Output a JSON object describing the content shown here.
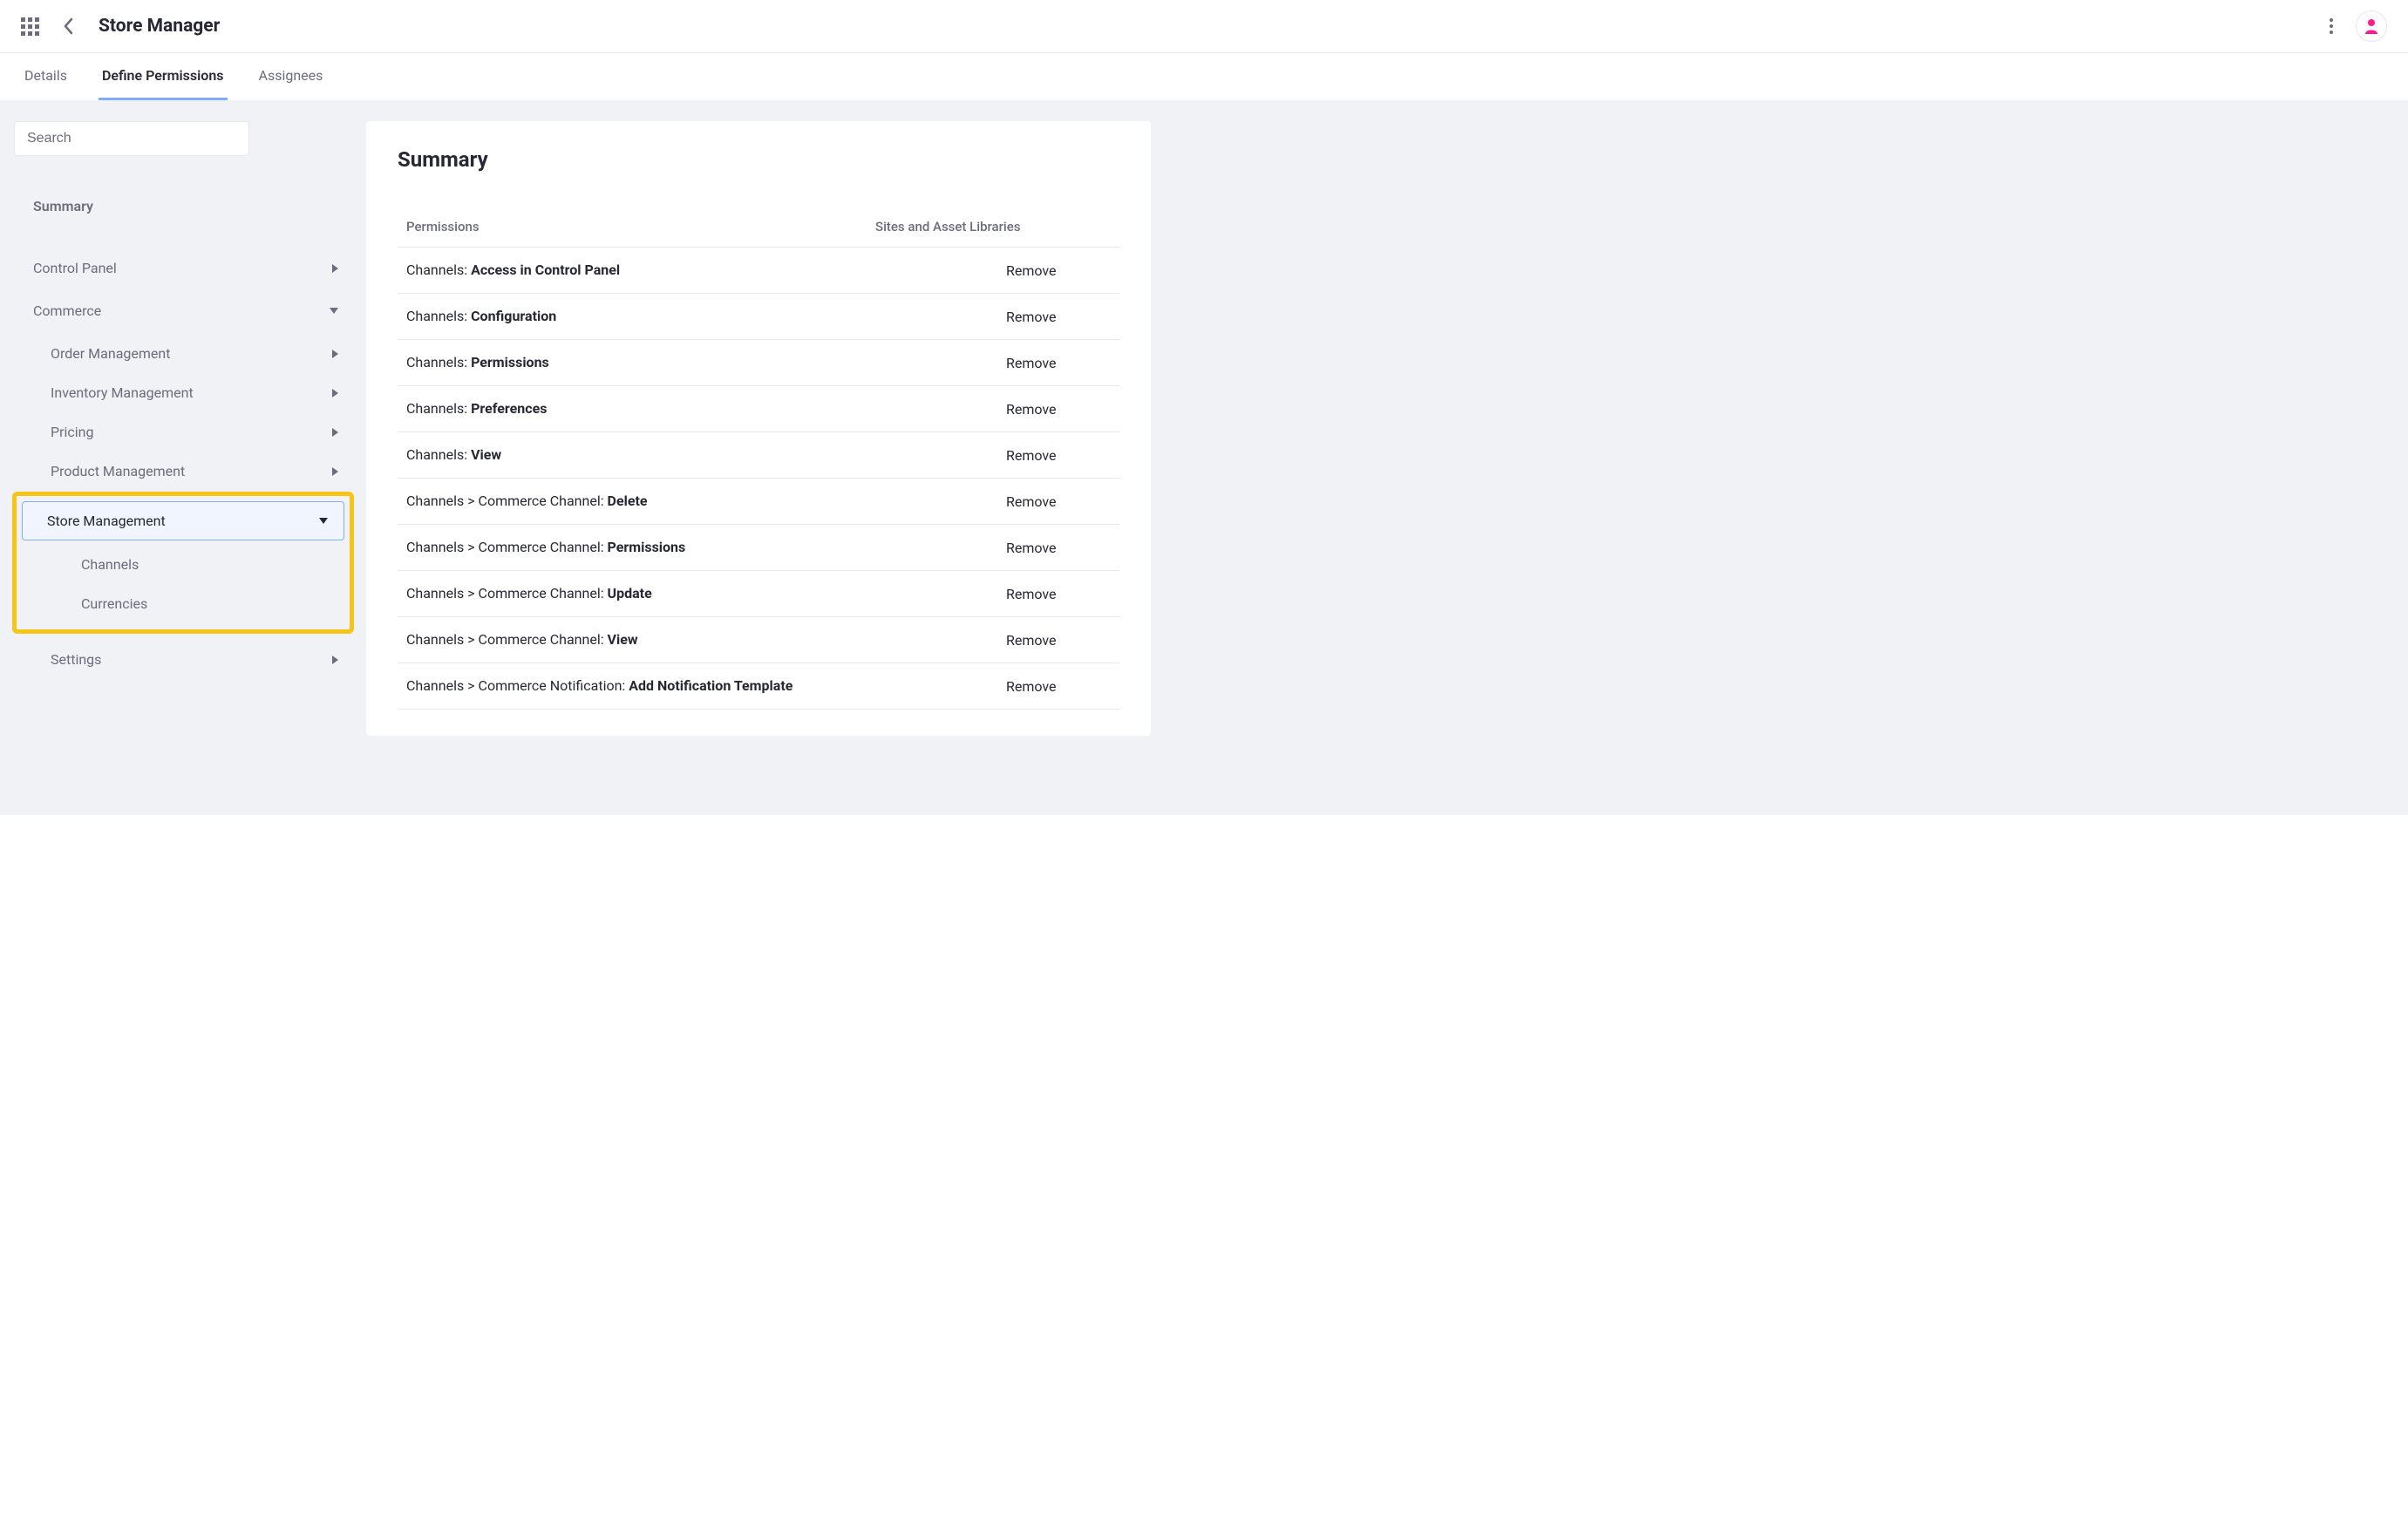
{
  "header": {
    "title": "Store Manager"
  },
  "tabs": [
    {
      "label": "Details",
      "active": false
    },
    {
      "label": "Define Permissions",
      "active": true
    },
    {
      "label": "Assignees",
      "active": false
    }
  ],
  "search": {
    "placeholder": "Search"
  },
  "sidebar": {
    "summary_label": "Summary",
    "control_panel_label": "Control Panel",
    "commerce_label": "Commerce",
    "order_mgmt_label": "Order Management",
    "inventory_mgmt_label": "Inventory Management",
    "pricing_label": "Pricing",
    "product_mgmt_label": "Product Management",
    "store_mgmt_label": "Store Management",
    "channels_label": "Channels",
    "currencies_label": "Currencies",
    "settings_label": "Settings"
  },
  "content": {
    "summary_title": "Summary",
    "col_permissions": "Permissions",
    "col_sites": "Sites and Asset Libraries",
    "remove_label": "Remove",
    "rows": [
      {
        "prefix": "Channels: ",
        "bold": "Access in Control Panel"
      },
      {
        "prefix": "Channels: ",
        "bold": "Configuration"
      },
      {
        "prefix": "Channels: ",
        "bold": "Permissions"
      },
      {
        "prefix": "Channels: ",
        "bold": "Preferences"
      },
      {
        "prefix": "Channels: ",
        "bold": "View"
      },
      {
        "prefix": "Channels > Commerce Channel: ",
        "bold": "Delete"
      },
      {
        "prefix": "Channels > Commerce Channel: ",
        "bold": "Permissions"
      },
      {
        "prefix": "Channels > Commerce Channel: ",
        "bold": "Update"
      },
      {
        "prefix": "Channels > Commerce Channel: ",
        "bold": "View"
      },
      {
        "prefix": "Channels > Commerce Notification: ",
        "bold": "Add Notification Template"
      }
    ]
  }
}
